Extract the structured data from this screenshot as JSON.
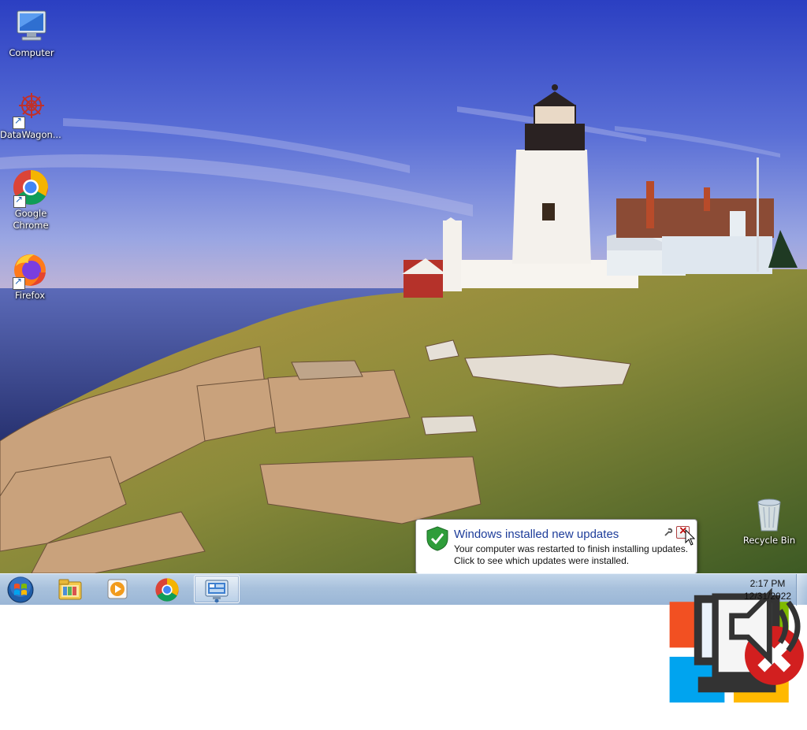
{
  "desktop": {
    "icons": [
      {
        "label": "Computer"
      },
      {
        "label": "DataWagon..."
      },
      {
        "label": "Google\nChrome",
        "line1": "Google",
        "line2": "Chrome"
      },
      {
        "label": "Firefox"
      }
    ],
    "recycle_bin": {
      "label": "Recycle Bin"
    }
  },
  "notification": {
    "title": "Windows installed new updates",
    "line1": "Your computer was restarted to finish installing updates.",
    "line2": "Click to see which updates were installed.",
    "shield_color": "#2e9d3a"
  },
  "taskbar": {
    "pinned": [
      {
        "icon": "start-orb-icon"
      },
      {
        "icon": "file-explorer-icon"
      },
      {
        "icon": "media-player-icon"
      },
      {
        "icon": "chrome-icon"
      },
      {
        "icon": "control-panel-icon",
        "active": true
      }
    ],
    "tray": {
      "icons": [
        "windows-flag-icon",
        "network-icon",
        "action-center-icon",
        "volume-icon"
      ],
      "time": "2:17 PM",
      "date": "12/31/2022"
    }
  },
  "colors": {
    "taskbar": "#a8c1dc",
    "notification_title": "#1e3d9a"
  }
}
